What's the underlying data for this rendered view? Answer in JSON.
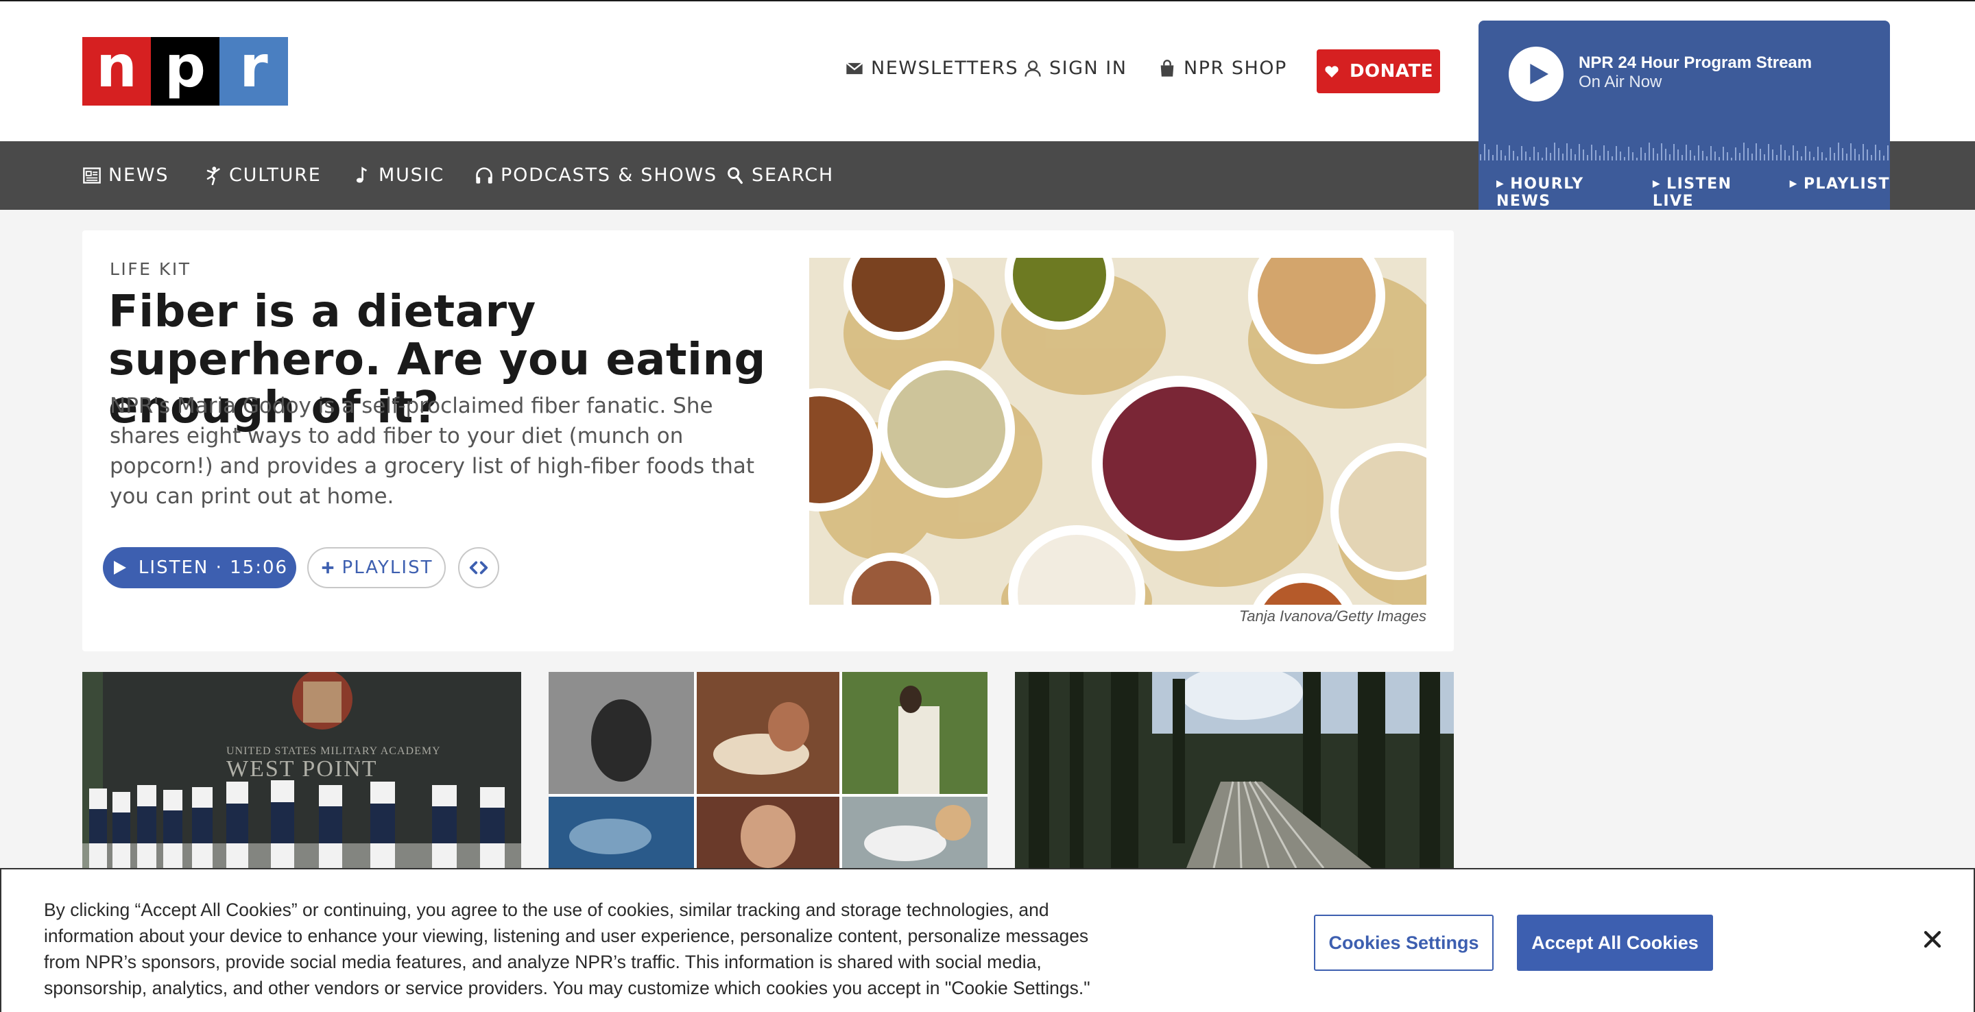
{
  "logo": {
    "letters": [
      "n",
      "p",
      "r"
    ],
    "colors": [
      "#d62021",
      "#000000",
      "#4a7fc1"
    ]
  },
  "utility": {
    "newsletters": "NEWSLETTERS",
    "sign_in": "SIGN IN",
    "shop": "NPR SHOP",
    "donate": "DONATE",
    "icons": [
      "envelope-icon",
      "user-icon",
      "shopping-bag-icon",
      "heart-icon"
    ]
  },
  "player": {
    "title": "NPR 24 Hour Program Stream",
    "subtitle": "On Air Now",
    "links": [
      "HOURLY NEWS",
      "LISTEN LIVE",
      "PLAYLIST"
    ],
    "color": "#3d5b9a"
  },
  "nav": {
    "items": [
      {
        "label": "NEWS",
        "icon": "newspaper-icon"
      },
      {
        "label": "CULTURE",
        "icon": "dancer-icon"
      },
      {
        "label": "MUSIC",
        "icon": "music-note-icon"
      },
      {
        "label": "PODCASTS & SHOWS",
        "icon": "headphones-icon"
      },
      {
        "label": "SEARCH",
        "icon": "search-icon"
      }
    ]
  },
  "story": {
    "kicker": "LIFE KIT",
    "headline": "Fiber is a dietary superhero. Are you eating enough of it?",
    "teaser": "NPR's Maria Godoy is a self-proclaimed fiber fanatic. She shares eight ways to add fiber to your diet (munch on popcorn!) and provides a grocery list of high-fiber foods that you can print out at home.",
    "listen_label": "LISTEN · 15:06",
    "playlist_label": "PLAYLIST",
    "image_credit": "Tanja Ivanova/Getty Images"
  },
  "thumbnails": {
    "west_point_sign": "UNITED STATES MILITARY ACADEMY",
    "west_point_name": "WEST POINT"
  },
  "cookie": {
    "text": "By clicking “Accept All Cookies” or continuing, you agree to the use of cookies, similar tracking and storage technologies, and information about your device to enhance your viewing, listening and user experience, personalize content, personalize messages from NPR’s sponsors, provide social media features, and analyze NPR’s traffic. This information is shared with social media, sponsorship, analytics, and other vendors or service providers. You may customize which cookies you accept in \"Cookie Settings.\"",
    "settings_label": "Cookies Settings",
    "accept_label": "Accept All Cookies"
  },
  "colors": {
    "brand_blue": "#3d5fb0",
    "donate_red": "#d62021",
    "nav_gray": "#4a4a4a"
  }
}
